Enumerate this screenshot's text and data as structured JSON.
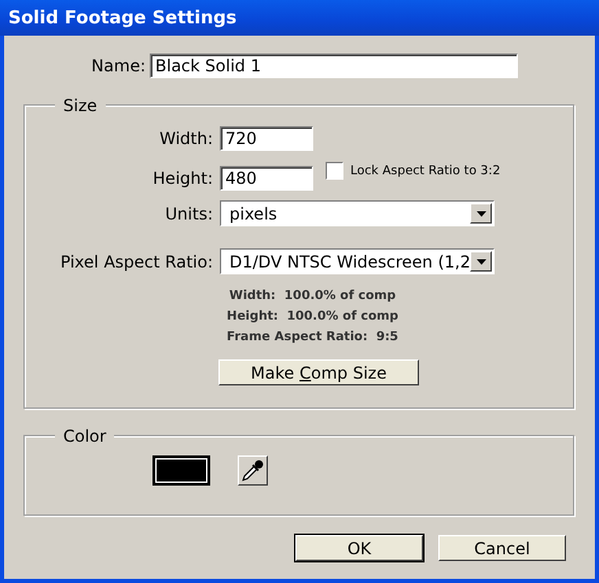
{
  "window": {
    "title": "Solid Footage Settings"
  },
  "name_field": {
    "label": "Name:",
    "value": "Black Solid 1"
  },
  "size": {
    "legend": "Size",
    "width": {
      "label": "Width:",
      "value": "720"
    },
    "height": {
      "label": "Height:",
      "value": "480"
    },
    "lock": {
      "label": "Lock Aspect Ratio to 3:2",
      "checked": false
    },
    "units": {
      "label": "Units:",
      "value": "pixels"
    },
    "pixel_aspect": {
      "label": "Pixel Aspect Ratio:",
      "value": "D1/DV NTSC Widescreen (1,2"
    },
    "info": [
      {
        "label": "Width:",
        "value": "100.0% of comp"
      },
      {
        "label": "Height:",
        "value": "100.0% of comp"
      },
      {
        "label": "Frame Aspect Ratio:",
        "value": "9:5"
      }
    ],
    "make_comp": {
      "before": "Make ",
      "accesskey": "C",
      "after": "omp Size"
    }
  },
  "color": {
    "legend": "Color",
    "swatch": {
      "color": "#000000"
    }
  },
  "buttons": [
    {
      "label": "OK",
      "default": true
    },
    {
      "label": "Cancel",
      "default": false
    }
  ]
}
